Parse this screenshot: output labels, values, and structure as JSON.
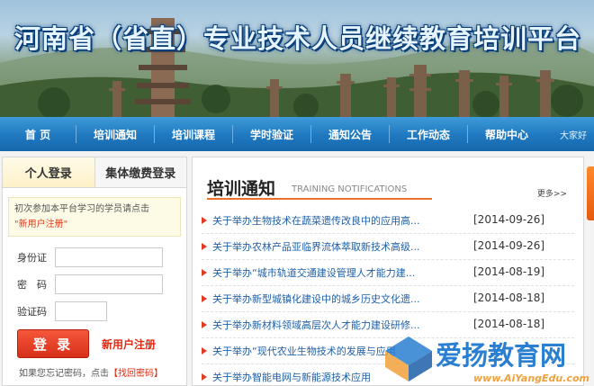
{
  "banner": {
    "title": "河南省（省直）专业技术人员继续教育培训平台"
  },
  "nav": {
    "items": [
      "首 页",
      "培训通知",
      "培训课程",
      "学时验证",
      "通知公告",
      "工作动态",
      "帮助中心"
    ],
    "greeting": "大家好"
  },
  "login": {
    "tabs": [
      "个人登录",
      "集体缴费登录"
    ],
    "notice_text": "初次参加本平台学习的学员请点击",
    "notice_link": "\"新用户注册\"",
    "fields": {
      "id_label": "身份证",
      "password_label": "密　码",
      "captcha_label": "验证码"
    },
    "login_button": "登 录",
    "register_link": "新用户注册",
    "forgot_text": "如果您忘记密码，点击",
    "forgot_link": "【找回密码】"
  },
  "news": {
    "title": "培训通知",
    "subtitle": "TRAINING NOTIFICATIONS",
    "more": "更多>>",
    "items": [
      {
        "text": "关于举办生物技术在蔬菜遗传改良中的应用高...",
        "date": "[2014-09-26]"
      },
      {
        "text": "关于举办农林产品亚临界流体萃取新技术高级...",
        "date": "[2014-09-26]"
      },
      {
        "text": "关于举办“城市轨道交通建设管理人才能力建...",
        "date": "[2014-08-19]"
      },
      {
        "text": "关于举办新型城镇化建设中的城乡历史文化遗...",
        "date": "[2014-08-18]"
      },
      {
        "text": "关于举办新材料领域高层次人才能力建设研修...",
        "date": "[2014-08-18]"
      },
      {
        "text": "关于举办“现代农业生物技术的发展与应用",
        "date": ""
      },
      {
        "text": "关于举办智能电网与新能源技术应用",
        "date": ""
      }
    ]
  },
  "watermark": {
    "name": "爱扬教育网",
    "url": "www.AiYangEdu.com"
  },
  "colors": {
    "nav": "#1f78bf",
    "accent": "#e8722d",
    "link": "#1e5fa8",
    "button": "#d8301a"
  }
}
